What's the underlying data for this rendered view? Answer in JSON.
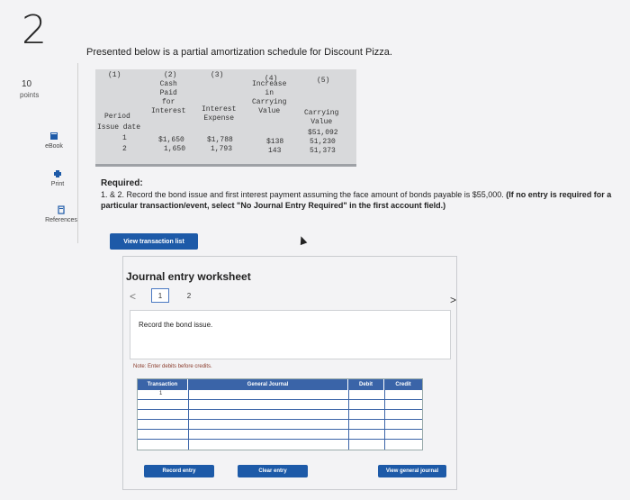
{
  "question": {
    "number": "2",
    "points_value": "10",
    "points_label": "points",
    "intro": "Presented below is a partial amortization schedule for Discount Pizza."
  },
  "sidebar": {
    "items": [
      {
        "label": "eBook",
        "icon": "ebook-icon"
      },
      {
        "label": "Print",
        "icon": "print-icon"
      },
      {
        "label": "References",
        "icon": "references-icon"
      }
    ]
  },
  "schedule": {
    "col_numbers": [
      "(1)",
      "(2)",
      "(3)",
      "(4)",
      "(5)"
    ],
    "headers": {
      "period": "Period",
      "cash_paid": "Cash\nPaid\nfor\nInterest",
      "interest_expense": "Interest\nExpense",
      "increase": "Increase\nin\nCarrying\nValue",
      "carrying_value": "Carrying\nValue"
    },
    "issue_label": "Issue date",
    "issue_value": "$51,092",
    "rows": [
      {
        "period": "1",
        "cash": "$1,650",
        "interest": "$1,788",
        "increase": "$138",
        "carrying": "51,230"
      },
      {
        "period": "2",
        "cash": "1,650",
        "interest": "1,793",
        "increase": "143",
        "carrying": "51,373"
      }
    ]
  },
  "required": {
    "title": "Required:",
    "body_plain": "1. & 2. Record the bond issue and first interest payment assuming the face amount of bonds payable is $55,000.",
    "body_bold": "(If no entry is required for a particular transaction/event, select \"No Journal Entry Required\" in the first account field.)"
  },
  "buttons": {
    "view_transaction_list": "View transaction list",
    "record_entry": "Record entry",
    "clear_entry": "Clear entry",
    "view_general_journal": "View general journal"
  },
  "worksheet": {
    "title": "Journal entry worksheet",
    "pages": [
      "1",
      "2"
    ],
    "active_page": "1",
    "prev": "<",
    "next": ">",
    "instruction": "Record the bond issue.",
    "note": "Note: Enter debits before credits.",
    "columns": [
      "Transaction",
      "General Journal",
      "Debit",
      "Credit"
    ],
    "transaction": "1",
    "row_count": 6
  }
}
